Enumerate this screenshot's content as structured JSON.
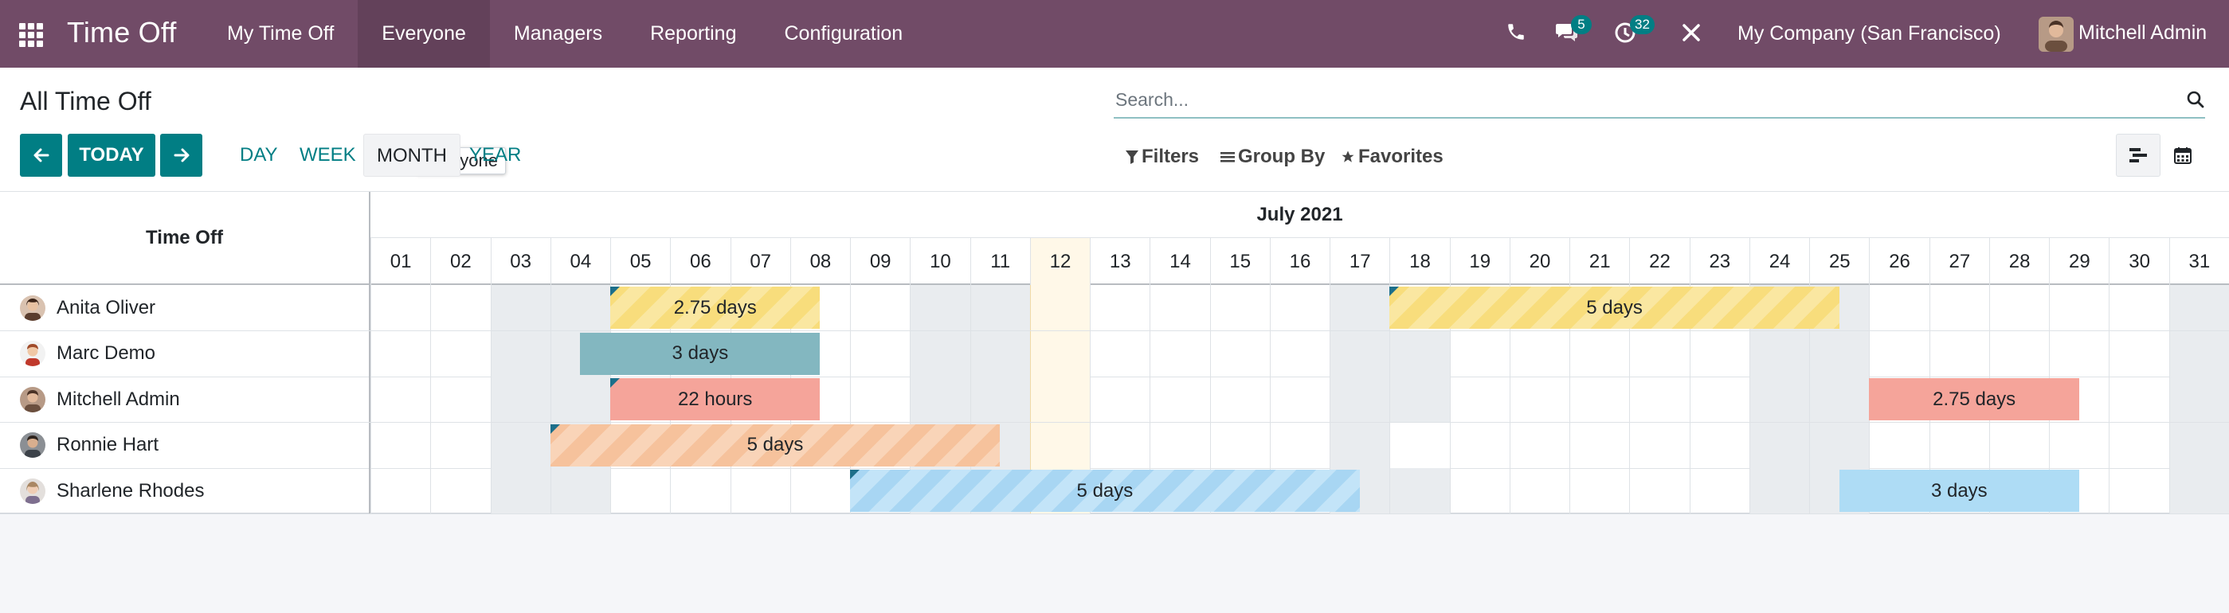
{
  "navbar": {
    "brand": "Time Off",
    "menu": [
      "My Time Off",
      "Everyone",
      "Managers",
      "Reporting",
      "Configuration"
    ],
    "active": "Everyone",
    "messages_count": "5",
    "activities_count": "32",
    "company": "My Company (San Francisco)",
    "user": "Mitchell Admin"
  },
  "control": {
    "title": "All Time Off",
    "tooltip": "Everyone",
    "search_placeholder": "Search...",
    "today_label": "TODAY",
    "scales": [
      "DAY",
      "WEEK",
      "MONTH",
      "YEAR"
    ],
    "active_scale": "MONTH",
    "filters_label": "Filters",
    "groupby_label": "Group By",
    "favorites_label": "Favorites"
  },
  "gantt": {
    "header_label": "Time Off",
    "month": "July 2021",
    "days": [
      "01",
      "02",
      "03",
      "04",
      "05",
      "06",
      "07",
      "08",
      "09",
      "10",
      "11",
      "12",
      "13",
      "14",
      "15",
      "16",
      "17",
      "18",
      "19",
      "20",
      "21",
      "22",
      "23",
      "24",
      "25",
      "26",
      "27",
      "28",
      "29",
      "30",
      "31"
    ],
    "today": "12",
    "rows": [
      {
        "name": "Anita Oliver",
        "offdays": [
          3,
          4,
          10,
          11,
          17,
          24,
          25,
          31
        ],
        "pills": [
          {
            "start": 5,
            "end": 7.5,
            "label": "2.75 days",
            "style": "stripe-yellow",
            "corner": true
          },
          {
            "start": 18,
            "end": 24.5,
            "label": "5 days",
            "style": "stripe-yellow",
            "corner": true
          }
        ]
      },
      {
        "name": "Marc Demo",
        "offdays": [
          3,
          4,
          10,
          11,
          17,
          18,
          24,
          25,
          31
        ],
        "pills": [
          {
            "start": 4.5,
            "end": 7.5,
            "label": "3 days",
            "style": "solid-teal",
            "corner": false
          }
        ]
      },
      {
        "name": "Mitchell Admin",
        "offdays": [
          3,
          4,
          10,
          11,
          17,
          18,
          24,
          25,
          31
        ],
        "pills": [
          {
            "start": 5,
            "end": 7.5,
            "label": "22 hours",
            "style": "solid-red",
            "corner": true
          },
          {
            "start": 26,
            "end": 28.5,
            "label": "2.75 days",
            "style": "solid-red",
            "corner": false
          }
        ]
      },
      {
        "name": "Ronnie Hart",
        "offdays": [
          3,
          4,
          10,
          11,
          17,
          24,
          25,
          31
        ],
        "pills": [
          {
            "start": 4,
            "end": 10.5,
            "label": "5 days",
            "style": "stripe-orange",
            "corner": true
          }
        ]
      },
      {
        "name": "Sharlene Rhodes",
        "offdays": [
          3,
          4,
          10,
          11,
          17,
          18,
          24,
          25,
          31
        ],
        "pills": [
          {
            "start": 9,
            "end": 16.5,
            "label": "5 days",
            "style": "stripe-blue",
            "corner": true
          },
          {
            "start": 25.5,
            "end": 28.5,
            "label": "3 days",
            "style": "solid-blue",
            "corner": false
          }
        ]
      }
    ]
  }
}
